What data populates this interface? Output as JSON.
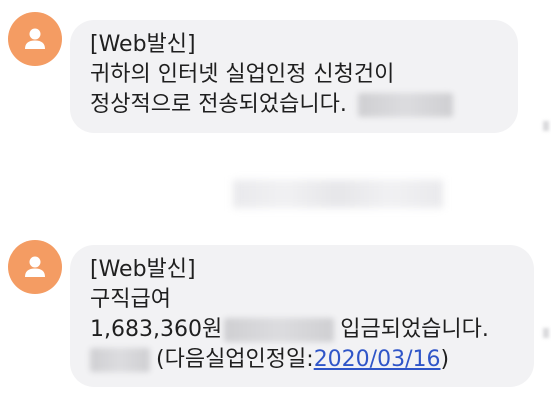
{
  "messages": [
    {
      "lines": [
        "[Web발신]",
        "귀하의 인터넷 실업인정 신청건이",
        "정상적으로 전송되었습니다."
      ]
    },
    {
      "lines": [
        "[Web발신]",
        "구직급여"
      ],
      "amount_text": "1,683,360원",
      "deposit_text": "입금되었습니다.",
      "next_date_prefix": "(다음실업인정일:",
      "next_date_link": "2020/03/16",
      "next_date_suffix": ")"
    }
  ],
  "colors": {
    "avatar": "#f49c63",
    "bubble": "#f2f2f4",
    "link": "#2f55c8"
  },
  "icons": {
    "avatar": "person-icon"
  }
}
